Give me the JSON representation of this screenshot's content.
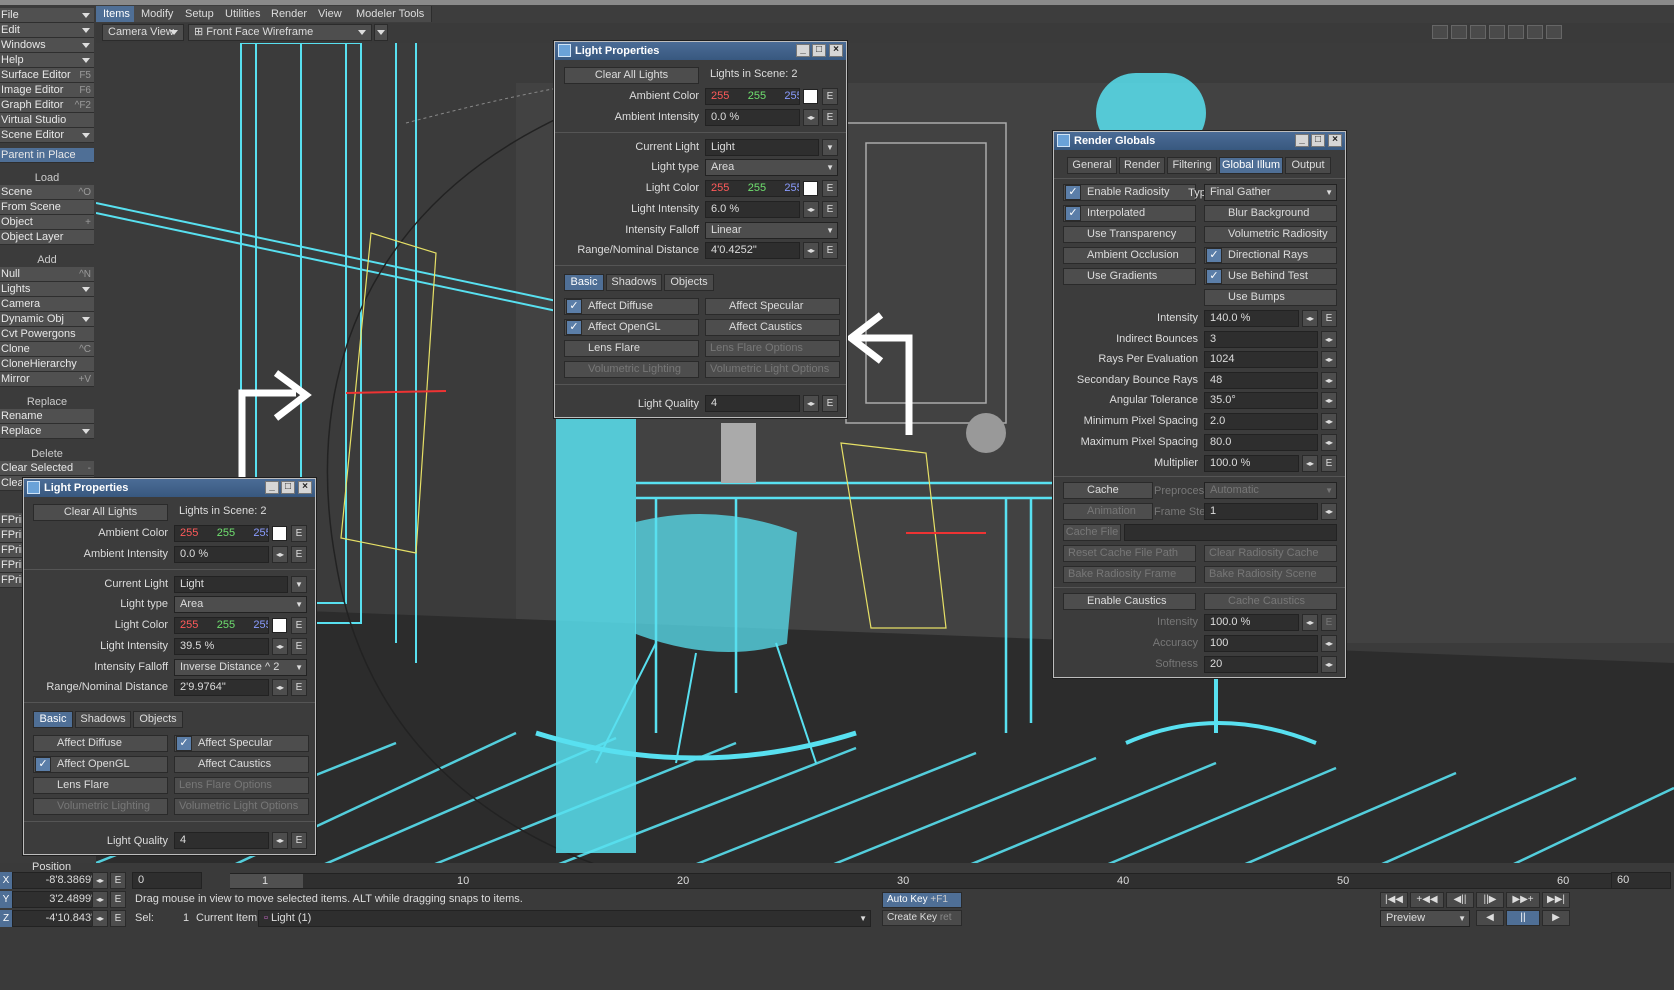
{
  "left_panel": {
    "menus": [
      {
        "label": "File",
        "shortcut": "",
        "dropdown": true
      },
      {
        "label": "Edit",
        "shortcut": "",
        "dropdown": true
      },
      {
        "label": "Windows",
        "shortcut": "",
        "dropdown": true
      },
      {
        "label": "Help",
        "shortcut": "",
        "dropdown": true
      },
      {
        "label": "Surface Editor",
        "shortcut": "F5",
        "dropdown": false
      },
      {
        "label": "Image Editor",
        "shortcut": "F6",
        "dropdown": false
      },
      {
        "label": "Graph Editor",
        "shortcut": "^F2",
        "dropdown": false
      },
      {
        "label": "Virtual Studio",
        "shortcut": "",
        "dropdown": false
      },
      {
        "label": "Scene Editor",
        "shortcut": "",
        "dropdown": true
      }
    ],
    "parent_in_place": "Parent in Place",
    "load_header": "Load",
    "load_items": [
      {
        "label": "Scene",
        "shortcut": "^O"
      },
      {
        "label": "From Scene",
        "shortcut": ""
      },
      {
        "label": "Object",
        "shortcut": "+"
      },
      {
        "label": "Object Layer",
        "shortcut": ""
      }
    ],
    "add_header": "Add",
    "add_items": [
      {
        "label": "Null",
        "shortcut": "^N",
        "dropdown": false
      },
      {
        "label": "Lights",
        "shortcut": "",
        "dropdown": true
      },
      {
        "label": "Camera",
        "shortcut": "",
        "dropdown": false
      },
      {
        "label": "Dynamic Obj",
        "shortcut": "",
        "dropdown": true
      },
      {
        "label": "Cvt Powergons",
        "shortcut": "",
        "dropdown": false
      },
      {
        "label": "Clone",
        "shortcut": "^C",
        "dropdown": false
      },
      {
        "label": "CloneHierarchy",
        "shortcut": "",
        "dropdown": false
      },
      {
        "label": "Mirror",
        "shortcut": "+V",
        "dropdown": false
      }
    ],
    "replace_header": "Replace",
    "replace_items": [
      {
        "label": "Rename",
        "dropdown": false
      },
      {
        "label": "Replace",
        "dropdown": true
      }
    ],
    "delete_header": "Delete",
    "delete_items": [
      {
        "label": "Clear Selected",
        "shortcut": "-"
      },
      {
        "label": "Clear",
        "shortcut": ""
      }
    ],
    "fprint_items": [
      "FPrin",
      "FPrin",
      "FPrin",
      "FPrin",
      "FPrin"
    ]
  },
  "menubar": {
    "tabs": [
      "Items",
      "Modify",
      "Setup",
      "Utilities",
      "Render",
      "View",
      "Modeler Tools"
    ],
    "active": "Items"
  },
  "viewport_bar": {
    "view": "Camera View",
    "shading": "Front Face Wireframe"
  },
  "light_props_top": {
    "title": "Light Properties",
    "clear_all": "Clear All Lights",
    "lights_in_scene": "Lights in Scene: 2",
    "ambient_color_label": "Ambient Color",
    "ambient_r": "255",
    "ambient_g": "255",
    "ambient_b": "255",
    "ambient_intensity_label": "Ambient Intensity",
    "ambient_intensity": "0.0 %",
    "current_light_label": "Current Light",
    "current_light": "Light",
    "light_type_label": "Light type",
    "light_type": "Area",
    "light_color_label": "Light Color",
    "light_r": "255",
    "light_g": "255",
    "light_b": "255",
    "light_intensity_label": "Light Intensity",
    "light_intensity": "6.0 %",
    "falloff_label": "Intensity Falloff",
    "falloff": "Linear",
    "range_label": "Range/Nominal Distance",
    "range": "4'0.4252\"",
    "tabs": [
      "Basic",
      "Shadows",
      "Objects"
    ],
    "affect_diffuse": "Affect Diffuse",
    "affect_specular": "Affect Specular",
    "affect_opengl": "Affect OpenGL",
    "affect_caustics": "Affect Caustics",
    "lens_flare": "Lens Flare",
    "lens_flare_options": "Lens Flare Options",
    "volumetric_lighting": "Volumetric Lighting",
    "volumetric_options": "Volumetric Light Options",
    "light_quality_label": "Light Quality",
    "light_quality": "4",
    "e": "E"
  },
  "light_props_bottom": {
    "title": "Light Properties",
    "clear_all": "Clear All Lights",
    "lights_in_scene": "Lights in Scene: 2",
    "ambient_color_label": "Ambient Color",
    "ambient_r": "255",
    "ambient_g": "255",
    "ambient_b": "255",
    "ambient_intensity_label": "Ambient Intensity",
    "ambient_intensity": "0.0 %",
    "current_light_label": "Current Light",
    "current_light": "Light",
    "light_type_label": "Light type",
    "light_type": "Area",
    "light_color_label": "Light Color",
    "light_r": "255",
    "light_g": "255",
    "light_b": "255",
    "light_intensity_label": "Light Intensity",
    "light_intensity": "39.5 %",
    "falloff_label": "Intensity Falloff",
    "falloff": "Inverse Distance ^ 2",
    "range_label": "Range/Nominal Distance",
    "range": "2'9.9764\"",
    "tabs": [
      "Basic",
      "Shadows",
      "Objects"
    ],
    "affect_diffuse": "Affect Diffuse",
    "affect_specular": "Affect Specular",
    "affect_opengl": "Affect OpenGL",
    "affect_caustics": "Affect Caustics",
    "lens_flare": "Lens Flare",
    "lens_flare_options": "Lens Flare Options",
    "volumetric_lighting": "Volumetric Lighting",
    "volumetric_options": "Volumetric Light Options",
    "light_quality_label": "Light Quality",
    "light_quality": "4",
    "e": "E"
  },
  "render_globals": {
    "title": "Render Globals",
    "tabs": [
      "General",
      "Render",
      "Filtering",
      "Global Illum",
      "Output"
    ],
    "active_tab": "Global Illum",
    "enable_radiosity": "Enable Radiosity",
    "type_label": "Type",
    "type": "Final Gather",
    "interpolated": "Interpolated",
    "blur_background": "Blur Background",
    "use_transparency": "Use Transparency",
    "volumetric_radiosity": "Volumetric Radiosity",
    "ambient_occlusion": "Ambient Occlusion",
    "directional_rays": "Directional Rays",
    "use_gradients": "Use Gradients",
    "use_behind_test": "Use Behind Test",
    "use_bumps": "Use Bumps",
    "intensity_label": "Intensity",
    "intensity": "140.0 %",
    "indirect_bounces_label": "Indirect Bounces",
    "indirect_bounces": "3",
    "rays_label": "Rays Per Evaluation",
    "rays": "1024",
    "secondary_label": "Secondary Bounce Rays",
    "secondary": "48",
    "angular_label": "Angular Tolerance",
    "angular": "35.0°",
    "min_spacing_label": "Minimum Pixel Spacing",
    "min_spacing": "2.0",
    "max_spacing_label": "Maximum Pixel Spacing",
    "max_spacing": "80.0",
    "multiplier_label": "Multiplier",
    "multiplier": "100.0 %",
    "cache": "Cache",
    "preprocess_label": "Preprocess",
    "preprocess": "Automatic",
    "animation": "Animation",
    "frame_steps_label": "Frame Steps",
    "frame_steps": "1",
    "cache_file": "Cache File",
    "reset_cache": "Reset Cache File Path",
    "clear_cache": "Clear Radiosity Cache",
    "bake_frame": "Bake Radiosity Frame",
    "bake_scene": "Bake Radiosity Scene",
    "enable_caustics": "Enable Caustics",
    "cache_caustics": "Cache Caustics",
    "c_intensity_label": "Intensity",
    "c_intensity": "100.0 %",
    "accuracy_label": "Accuracy",
    "accuracy": "100",
    "softness_label": "Softness",
    "softness": "20",
    "e": "E"
  },
  "timeline": {
    "position_label": "Position",
    "x_label": "X",
    "x_val": "-8'8.3869\"",
    "y_label": "Y",
    "y_val": "3'2.4899\"",
    "z_label": "Z",
    "z_val": "-4'10.843\"",
    "frame_field": "0",
    "current_frame": "1",
    "ticks": [
      "10",
      "20",
      "30",
      "40",
      "50",
      "60"
    ],
    "end_frame": "60",
    "status": "Drag mouse in view to move selected items. ALT while dragging snaps to items.",
    "sel_label": "Sel:",
    "sel_val": "1",
    "current_item_label": "Current Item",
    "current_item": "Light (1)",
    "auto_key": "Auto Key",
    "auto_key_sc": "+F1",
    "create_key": "Create Key",
    "create_key_sc": "ret",
    "preview": "Preview",
    "e": "E"
  }
}
